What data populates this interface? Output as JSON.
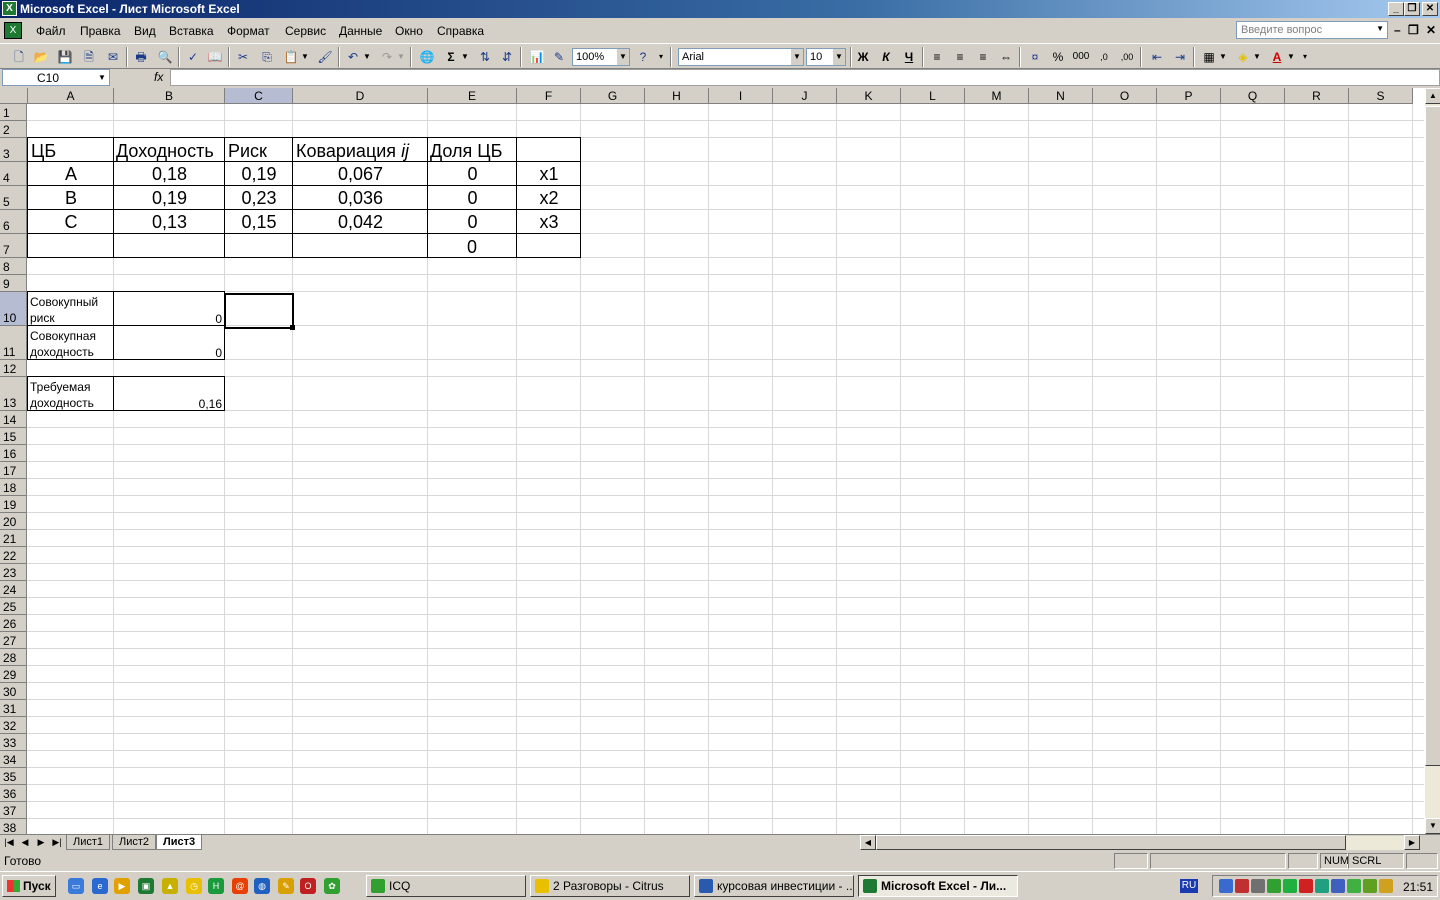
{
  "window": {
    "title": "Microsoft Excel - Лист Microsoft Excel"
  },
  "menu": {
    "items": [
      "Файл",
      "Правка",
      "Вид",
      "Вставка",
      "Формат",
      "Сервис",
      "Данные",
      "Окно",
      "Справка"
    ],
    "question_placeholder": "Введите вопрос"
  },
  "toolbar": {
    "zoom": "100%",
    "font": "Arial",
    "font_size": "10",
    "bold": "Ж",
    "italic": "К",
    "underline": "Ч",
    "sum": "Σ",
    "percent": "%",
    "thousands": "000"
  },
  "formula_bar": {
    "name_box": "C10",
    "fx": "fx",
    "formula": ""
  },
  "columns": [
    "A",
    "B",
    "C",
    "D",
    "E",
    "F",
    "G",
    "H",
    "I",
    "J",
    "K",
    "L",
    "M",
    "N",
    "O",
    "P",
    "Q",
    "R",
    "S"
  ],
  "rows": [
    "1",
    "2",
    "3",
    "4",
    "5",
    "6",
    "7",
    "8",
    "9",
    "10",
    "11",
    "12",
    "13",
    "14",
    "15",
    "16",
    "17",
    "18",
    "19",
    "20",
    "21",
    "22",
    "23",
    "24",
    "25",
    "26",
    "27",
    "28",
    "29",
    "30",
    "31",
    "32",
    "33",
    "34",
    "35",
    "36",
    "37",
    "38"
  ],
  "table": {
    "headers": [
      "ЦБ",
      "Доходность",
      "Риск",
      "Ковариация ",
      "Доля ЦБ"
    ],
    "cov_ij": "ij",
    "rows": [
      [
        "A",
        "0,18",
        "0,19",
        "0,067",
        "0",
        "x1"
      ],
      [
        "B",
        "0,19",
        "0,23",
        "0,036",
        "0",
        "x2"
      ],
      [
        "C",
        "0,13",
        "0,15",
        "0,042",
        "0",
        "x3"
      ]
    ],
    "total_share": "0"
  },
  "summary": {
    "risk_label": "Совокупный риск",
    "risk_value": "0",
    "return_label": "Совокупная доходность",
    "return_value": "0",
    "required_label": "Требуемая доходность",
    "required_value": "0,16"
  },
  "sheets": {
    "tabs": [
      "Лист1",
      "Лист2",
      "Лист3"
    ],
    "active": "Лист3"
  },
  "status": {
    "ready": "Готово",
    "num": "NUM",
    "scrl": "SCRL"
  },
  "taskbar": {
    "start": "Пуск",
    "buttons": [
      "ICQ",
      "2 Разговоры - Citrus",
      "курсовая инвестиции - ...",
      "Microsoft Excel - Ли..."
    ],
    "lang": "RU",
    "clock": "21:51"
  }
}
